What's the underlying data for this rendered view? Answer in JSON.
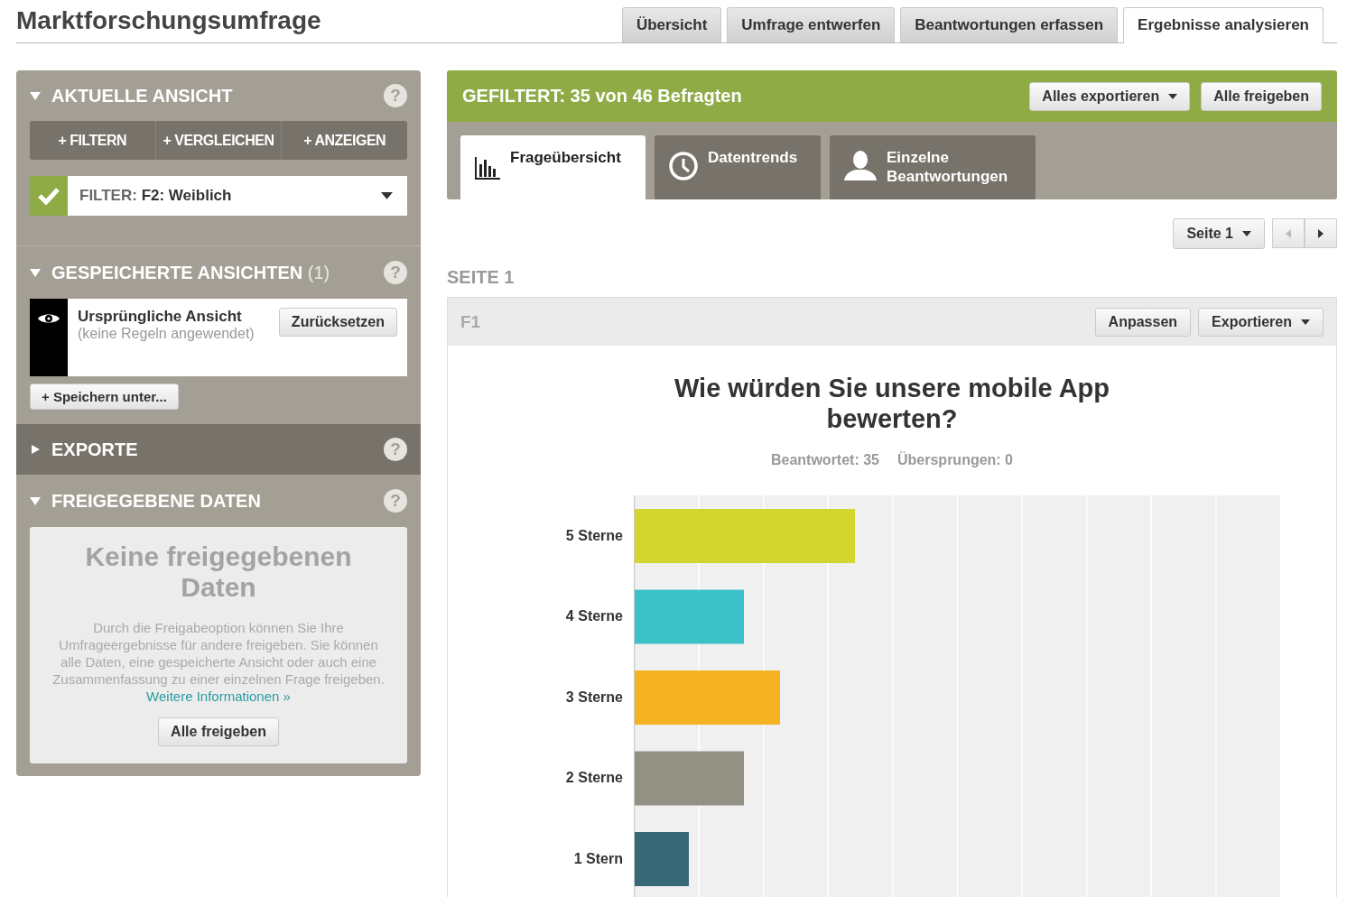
{
  "page_title": "Marktforschungsumfrage",
  "main_tabs": [
    {
      "label": "Übersicht",
      "selected": false
    },
    {
      "label": "Umfrage entwerfen",
      "selected": false
    },
    {
      "label": "Beantwortungen erfassen",
      "selected": false
    },
    {
      "label": "Ergebnisse analysieren",
      "selected": true
    }
  ],
  "current_view": {
    "title": "AKTUELLE ANSICHT",
    "expanded": true,
    "help": "?",
    "actions": [
      "+ FILTERN",
      "+ VERGLEICHEN",
      "+ ANZEIGEN"
    ],
    "filter": {
      "checked": true,
      "label": "FILTER:",
      "value": "F2: Weiblich"
    }
  },
  "saved_views": {
    "title": "GESPEICHERTE ANSICHTEN",
    "count": "(1)",
    "expanded": true,
    "help": "?",
    "views": [
      {
        "name": "Ursprüngliche Ansicht",
        "note": "(keine Regeln angewendet)",
        "button": "Zurücksetzen"
      }
    ],
    "save_button": "+ Speichern unter..."
  },
  "exports": {
    "title": "EXPORTE",
    "expanded": false,
    "help": "?"
  },
  "shared_data": {
    "title": "FREIGEGEBENE DATEN",
    "expanded": true,
    "help": "?",
    "empty_title": "Keine freigegebenen Daten",
    "empty_text": "Durch die Freigabeoption können Sie Ihre Umfrageergebnisse für andere freigeben. Sie können alle Daten, eine gespeicherte Ansicht oder auch eine Zusammenfassung zu einer einzelnen Frage freigeben.",
    "link": "Weitere Informationen »",
    "button": "Alle freigeben"
  },
  "filter_bar": {
    "text": "GEFILTERT: 35 von 46 Befragten",
    "buttons": [
      {
        "label": "Alles exportieren",
        "dropdown": true
      },
      {
        "label": "Alle freigeben",
        "dropdown": false
      }
    ]
  },
  "view_tabs": [
    {
      "label": "Frageübersicht",
      "kind": "chart",
      "selected": true
    },
    {
      "label": "Datentrends",
      "kind": "clock",
      "selected": false
    },
    {
      "label": "Einzelne Beantwortungen",
      "kind": "person",
      "selected": false
    }
  ],
  "pager": {
    "page": "Seite 1",
    "prev_disabled": true
  },
  "page_heading": "SEITE 1",
  "question": {
    "id": "F1",
    "buttons": [
      {
        "label": "Anpassen",
        "dropdown": false
      },
      {
        "label": "Exportieren",
        "dropdown": true
      }
    ],
    "title": "Wie würden Sie unsere mobile App bewerten?",
    "answered": "Beantwortet: 35",
    "skipped": "Übersprungen: 0",
    "bars": [
      {
        "label": "5 Sterne",
        "color": "#d3d62f"
      },
      {
        "label": "4 Sterne",
        "color": "#3dc1c8"
      },
      {
        "label": "3 Sterne",
        "color": "#f5b323"
      },
      {
        "label": "2 Sterne",
        "color": "#939184"
      },
      {
        "label": "1 Stern",
        "color": "#386776"
      }
    ]
  }
}
